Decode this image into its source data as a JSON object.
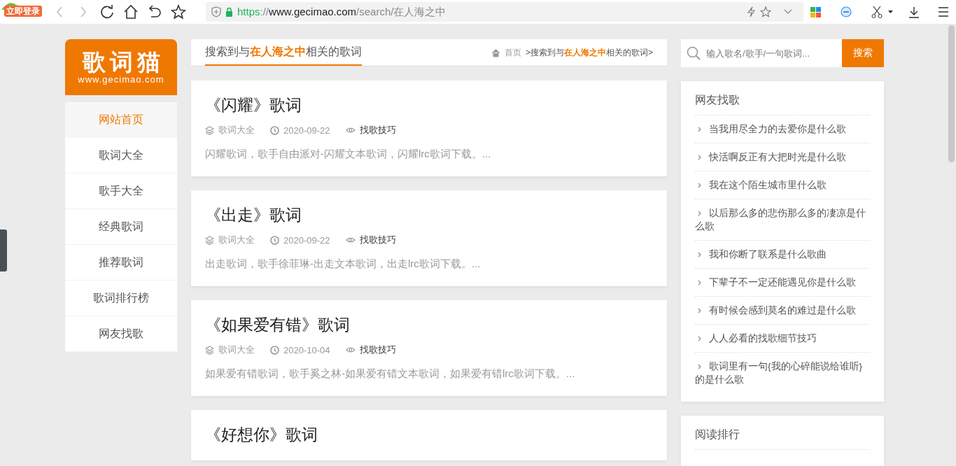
{
  "browser": {
    "login_badge": "立即登录",
    "url_parts": [
      {
        "kind": "scheme",
        "text": "https"
      },
      {
        "kind": "sep",
        "text": "://"
      },
      {
        "kind": "host",
        "text": "www.gecimao.com"
      },
      {
        "kind": "path",
        "text": "/search/在人海之中"
      }
    ]
  },
  "site": {
    "logo": {
      "title": "歌词猫",
      "domain": "www.gecimao.com"
    },
    "nav": [
      {
        "label": "网站首页",
        "selected": true
      },
      {
        "label": "歌词大全",
        "selected": false
      },
      {
        "label": "歌手大全",
        "selected": false
      },
      {
        "label": "经典歌词",
        "selected": false
      },
      {
        "label": "推荐歌词",
        "selected": false
      },
      {
        "label": "歌词排行榜",
        "selected": false
      },
      {
        "label": "网友找歌",
        "selected": false
      }
    ]
  },
  "search_header": {
    "title": "搜索到与**在人海之中**相关的歌词",
    "breadcrumb_home": "首页",
    "breadcrumb_trail": ">搜索到与**在人海之中**相关的歌词>"
  },
  "results": [
    {
      "title": "《闪耀》歌词",
      "category": "歌词大全",
      "date": "2020-09-22",
      "tag": "找歌技巧",
      "summary": "闪耀歌词，歌手自由派对-闪耀文本歌词，闪耀lrc歌词下载。..."
    },
    {
      "title": "《出走》歌词",
      "category": "歌词大全",
      "date": "2020-09-22",
      "tag": "找歌技巧",
      "summary": "出走歌词，歌手徐菲琳-出走文本歌词，出走lrc歌词下载。..."
    },
    {
      "title": "《如果爱有错》歌词",
      "category": "歌词大全",
      "date": "2020-10-04",
      "tag": "找歌技巧",
      "summary": "如果爱有错歌词，歌手奚之林-如果爱有错文本歌词，如果爱有错lrc歌词下载。..."
    },
    {
      "title": "《好想你》歌词"
    }
  ],
  "sidebar": {
    "search": {
      "placeholder": "输入歌名/歌手/一句歌词...",
      "button": "搜索"
    },
    "panels": [
      {
        "title": "网友找歌",
        "items": [
          "当我用尽全力的去爱你是什么歌",
          "快活啊反正有大把时光是什么歌",
          "我在这个陌生城市里什么歌",
          "以后那么多的悲伤那么多的凄凉是什么歌",
          "我和你断了联系是什么歌曲",
          "下辈子不一定还能遇见你是什么歌",
          "有时候会感到莫名的难过是什么歌",
          "人人必看的找歌细节技巧",
          "歌词里有一句{我的心碎能说给谁听}的是什么歌"
        ]
      },
      {
        "title": "阅读排行"
      }
    ]
  }
}
